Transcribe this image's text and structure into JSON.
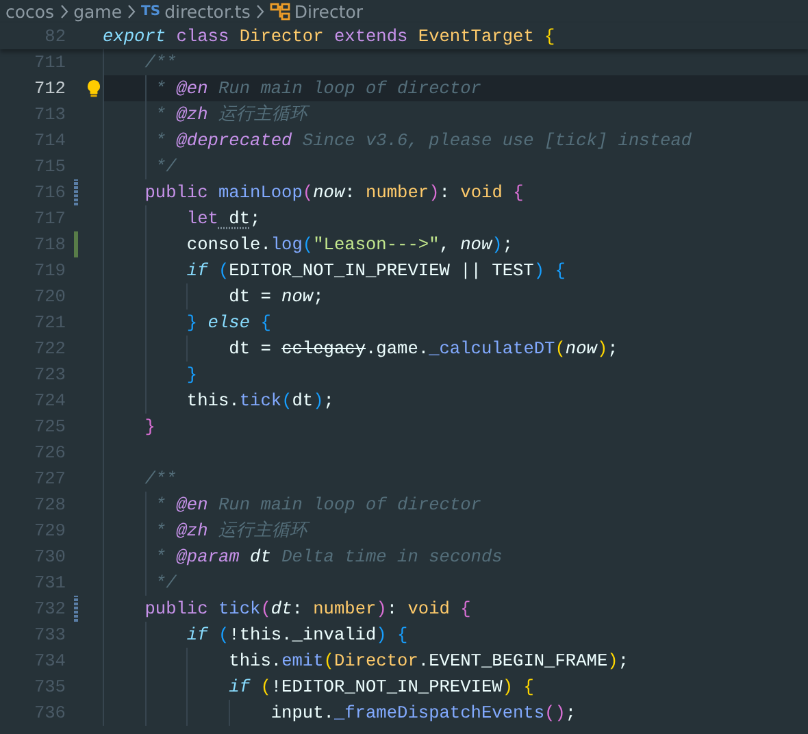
{
  "breadcrumbs": [
    {
      "kind": "folder",
      "label": "cocos"
    },
    {
      "kind": "folder",
      "label": "game"
    },
    {
      "kind": "file",
      "badge": "TS",
      "label": "director.ts"
    },
    {
      "kind": "class",
      "label": "Director"
    }
  ],
  "sticky_line": {
    "number": "82",
    "tokens": [
      {
        "t": "export",
        "kind": "kw-italic"
      },
      {
        "t": " class",
        "kind": "kw"
      },
      {
        "t": " Director",
        "kind": "type"
      },
      {
        "t": " extends",
        "kind": "kw"
      },
      {
        "t": " EventTarget",
        "kind": "type"
      },
      {
        "t": " {",
        "kind": "b1"
      }
    ]
  },
  "lines": [
    {
      "number": "711",
      "current": false,
      "tokens": [
        {
          "t": "    /**",
          "kind": "comment"
        }
      ]
    },
    {
      "number": "712",
      "current": true,
      "lightbulb": true,
      "tokens": [
        {
          "t": "     *",
          "kind": "comment"
        },
        {
          "t": " @en",
          "kind": "doc-tag"
        },
        {
          "t": " Run main loop of director",
          "kind": "comment"
        }
      ]
    },
    {
      "number": "713",
      "current": false,
      "tokens": [
        {
          "t": "     *",
          "kind": "comment"
        },
        {
          "t": " @zh",
          "kind": "doc-tag"
        },
        {
          "t": " 运行主循环",
          "kind": "comment"
        }
      ]
    },
    {
      "number": "714",
      "current": false,
      "tokens": [
        {
          "t": "     *",
          "kind": "comment"
        },
        {
          "t": " @deprecated",
          "kind": "doc-tag"
        },
        {
          "t": " Since v3.6, please use [tick] instead",
          "kind": "comment"
        }
      ]
    },
    {
      "number": "715",
      "current": false,
      "tokens": [
        {
          "t": "     */",
          "kind": "comment"
        }
      ]
    },
    {
      "number": "716",
      "current": false,
      "kind": "modified",
      "tokens": [
        {
          "t": "    public",
          "kind": "kw"
        },
        {
          "t": " mainLoop",
          "kind": "fn"
        },
        {
          "t": "(",
          "kind": "b2"
        },
        {
          "t": "now",
          "kind": "param"
        },
        {
          "t": ":",
          "kind": "plain"
        },
        {
          "t": " number",
          "kind": "type"
        },
        {
          "t": ")",
          "kind": "b2"
        },
        {
          "t": ":",
          "kind": "plain"
        },
        {
          "t": " void",
          "kind": "type"
        },
        {
          "t": " {",
          "kind": "b2"
        }
      ]
    },
    {
      "number": "717",
      "current": false,
      "tokens": [
        {
          "t": "        let",
          "kind": "kw"
        },
        {
          "t": " dt",
          "kind": "hinted"
        },
        {
          "t": ";",
          "kind": "plain"
        }
      ]
    },
    {
      "number": "718",
      "current": false,
      "kind": "added",
      "tokens": [
        {
          "t": "        console.",
          "kind": "plain"
        },
        {
          "t": "log",
          "kind": "fn"
        },
        {
          "t": "(",
          "kind": "b3"
        },
        {
          "t": "\"Leason--->\"",
          "kind": "str"
        },
        {
          "t": ",",
          "kind": "plain"
        },
        {
          "t": " now",
          "kind": "param"
        },
        {
          "t": ")",
          "kind": "b3"
        },
        {
          "t": ";",
          "kind": "plain"
        }
      ]
    },
    {
      "number": "719",
      "current": false,
      "tokens": [
        {
          "t": "        if",
          "kind": "kw-italic"
        },
        {
          "t": " (",
          "kind": "b3"
        },
        {
          "t": "EDITOR_NOT_IN_PREVIEW || TEST",
          "kind": "plain"
        },
        {
          "t": ")",
          "kind": "b3"
        },
        {
          "t": " {",
          "kind": "b3"
        }
      ]
    },
    {
      "number": "720",
      "current": false,
      "tokens": [
        {
          "t": "            dt =",
          "kind": "plain"
        },
        {
          "t": " now",
          "kind": "param"
        },
        {
          "t": ";",
          "kind": "plain"
        }
      ]
    },
    {
      "number": "721",
      "current": false,
      "tokens": [
        {
          "t": "        }",
          "kind": "b3"
        },
        {
          "t": " else",
          "kind": "kw-italic"
        },
        {
          "t": " {",
          "kind": "b3"
        }
      ]
    },
    {
      "number": "722",
      "current": false,
      "tokens": [
        {
          "t": "            dt = ",
          "kind": "plain"
        },
        {
          "t": "cclegacy",
          "kind": "deprecated"
        },
        {
          "t": ".game.",
          "kind": "plain"
        },
        {
          "t": "_calculateDT",
          "kind": "fn"
        },
        {
          "t": "(",
          "kind": "b1"
        },
        {
          "t": "now",
          "kind": "param"
        },
        {
          "t": ")",
          "kind": "b1"
        },
        {
          "t": ";",
          "kind": "plain"
        }
      ]
    },
    {
      "number": "723",
      "current": false,
      "tokens": [
        {
          "t": "        }",
          "kind": "b3"
        }
      ]
    },
    {
      "number": "724",
      "current": false,
      "tokens": [
        {
          "t": "        this.",
          "kind": "plain"
        },
        {
          "t": "tick",
          "kind": "fn"
        },
        {
          "t": "(",
          "kind": "b3"
        },
        {
          "t": "dt",
          "kind": "plain"
        },
        {
          "t": ")",
          "kind": "b3"
        },
        {
          "t": ";",
          "kind": "plain"
        }
      ]
    },
    {
      "number": "725",
      "current": false,
      "tokens": [
        {
          "t": "    }",
          "kind": "b2"
        }
      ]
    },
    {
      "number": "726",
      "current": false
    },
    {
      "number": "727",
      "current": false,
      "tokens": [
        {
          "t": "    /**",
          "kind": "comment"
        }
      ]
    },
    {
      "number": "728",
      "current": false,
      "tokens": [
        {
          "t": "     *",
          "kind": "comment"
        },
        {
          "t": " @en",
          "kind": "doc-tag"
        },
        {
          "t": " Run main loop of director",
          "kind": "comment"
        }
      ]
    },
    {
      "number": "729",
      "current": false,
      "tokens": [
        {
          "t": "     *",
          "kind": "comment"
        },
        {
          "t": " @zh",
          "kind": "doc-tag"
        },
        {
          "t": " 运行主循环",
          "kind": "comment"
        }
      ]
    },
    {
      "number": "730",
      "current": false,
      "tokens": [
        {
          "t": "     *",
          "kind": "comment"
        },
        {
          "t": " @param",
          "kind": "doc-tag"
        },
        {
          "t": " dt",
          "kind": "doc-param"
        },
        {
          "t": " Delta time in seconds",
          "kind": "comment"
        }
      ]
    },
    {
      "number": "731",
      "current": false,
      "tokens": [
        {
          "t": "     */",
          "kind": "comment"
        }
      ]
    },
    {
      "number": "732",
      "current": false,
      "kind": "modified",
      "tokens": [
        {
          "t": "    public",
          "kind": "kw"
        },
        {
          "t": " tick",
          "kind": "fn"
        },
        {
          "t": "(",
          "kind": "b2"
        },
        {
          "t": "dt",
          "kind": "param"
        },
        {
          "t": ":",
          "kind": "plain"
        },
        {
          "t": " number",
          "kind": "type"
        },
        {
          "t": ")",
          "kind": "b2"
        },
        {
          "t": ":",
          "kind": "plain"
        },
        {
          "t": " void",
          "kind": "type"
        },
        {
          "t": " {",
          "kind": "b2"
        }
      ]
    },
    {
      "number": "733",
      "current": false,
      "tokens": [
        {
          "t": "        if",
          "kind": "kw-italic"
        },
        {
          "t": " (",
          "kind": "b3"
        },
        {
          "t": "!this._invalid",
          "kind": "plain"
        },
        {
          "t": ")",
          "kind": "b3"
        },
        {
          "t": " {",
          "kind": "b3"
        }
      ]
    },
    {
      "number": "734",
      "current": false,
      "tokens": [
        {
          "t": "            this.",
          "kind": "plain"
        },
        {
          "t": "emit",
          "kind": "fn"
        },
        {
          "t": "(",
          "kind": "b1"
        },
        {
          "t": "Director",
          "kind": "type"
        },
        {
          "t": ".EVENT_BEGIN_FRAME",
          "kind": "plain"
        },
        {
          "t": ")",
          "kind": "b1"
        },
        {
          "t": ";",
          "kind": "plain"
        }
      ]
    },
    {
      "number": "735",
      "current": false,
      "tokens": [
        {
          "t": "            if",
          "kind": "kw-italic"
        },
        {
          "t": " (",
          "kind": "b1"
        },
        {
          "t": "!EDITOR_NOT_IN_PREVIEW",
          "kind": "plain"
        },
        {
          "t": ")",
          "kind": "b1"
        },
        {
          "t": " {",
          "kind": "b1"
        }
      ]
    },
    {
      "number": "736",
      "current": false,
      "tokens": [
        {
          "t": "                input.",
          "kind": "plain"
        },
        {
          "t": "_frameDispatchEvents",
          "kind": "fn"
        },
        {
          "t": "(",
          "kind": "b2"
        },
        {
          "t": ")",
          "kind": "b2"
        },
        {
          "t": ";",
          "kind": "plain"
        }
      ]
    }
  ]
}
